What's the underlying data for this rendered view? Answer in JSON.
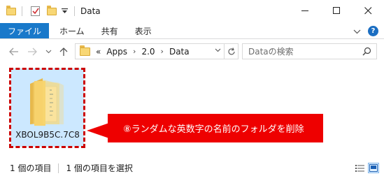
{
  "window": {
    "title": "Data",
    "minimize_glyph": "—",
    "maximize_glyph": "☐",
    "close_glyph": "✕"
  },
  "ribbon": {
    "tabs": [
      {
        "label": "ファイル",
        "active": true
      },
      {
        "label": "ホーム"
      },
      {
        "label": "共有"
      },
      {
        "label": "表示"
      }
    ],
    "expand_glyph": "∨",
    "help_glyph": "?"
  },
  "address": {
    "overflow": "«",
    "crumbs": [
      "Apps",
      "2.0",
      "Data"
    ],
    "separator": "›",
    "dropdown_glyph": "∨"
  },
  "search": {
    "placeholder": "Dataの検索"
  },
  "item": {
    "name": "XBOL9B5C.7C8"
  },
  "callout": {
    "text": "⑧ランダムな英数字の名前のフォルダを削除",
    "color": "#ee0000"
  },
  "status": {
    "item_count": "1 個の項目",
    "selected_count": "1 個の項目を選択"
  },
  "colors": {
    "accent": "#1979ca",
    "selection": "#cce8ff",
    "dash": "#cc0000"
  }
}
